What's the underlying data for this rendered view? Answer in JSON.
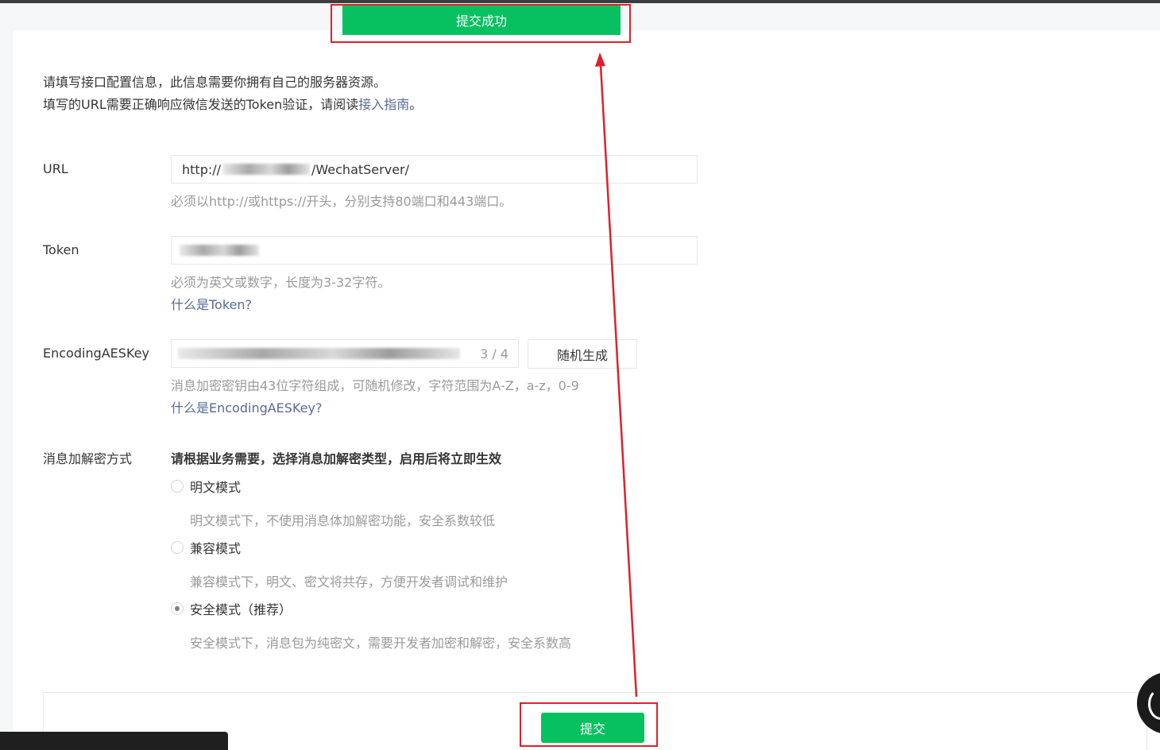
{
  "toast": {
    "text": "提交成功"
  },
  "intro": {
    "line1": "请填写接口配置信息，此信息需要你拥有自己的服务器资源。",
    "line2_prefix": "填写的URL需要正确响应微信发送的Token验证，请阅读",
    "line2_link": "接入指南",
    "line2_suffix": "。"
  },
  "url": {
    "label": "URL",
    "value_prefix": "http://",
    "value_suffix": "/WechatServer/",
    "hint": "必须以http://或https://开头，分别支持80端口和443端口。"
  },
  "token": {
    "label": "Token",
    "hint": "必须为英文或数字，长度为3-32字符。",
    "help_link": "什么是Token?"
  },
  "aeskey": {
    "label": "EncodingAESKey",
    "counter": "3 / 4",
    "generate_button": "随机生成",
    "hint": "消息加密密钥由43位字符组成，可随机修改，字符范围为A-Z，a-z，0-9",
    "help_link": "什么是EncodingAESKey?"
  },
  "encryption": {
    "label": "消息加解密方式",
    "title": "请根据业务需要，选择消息加解密类型，启用后将立即生效",
    "options": [
      {
        "label": "明文模式",
        "desc": "明文模式下，不使用消息体加解密功能，安全系数较低",
        "selected": false
      },
      {
        "label": "兼容模式",
        "desc": "兼容模式下，明文、密文将共存，方便开发者调试和维护",
        "selected": false
      },
      {
        "label": "安全模式（推荐）",
        "desc": "安全模式下，消息包为纯密文，需要开发者加密和解密，安全系数高",
        "selected": true
      }
    ]
  },
  "submit": {
    "label": "提交"
  },
  "colors": {
    "brand_green": "#07c160",
    "link": "#576b95",
    "annotation_red": "#e0202a"
  }
}
